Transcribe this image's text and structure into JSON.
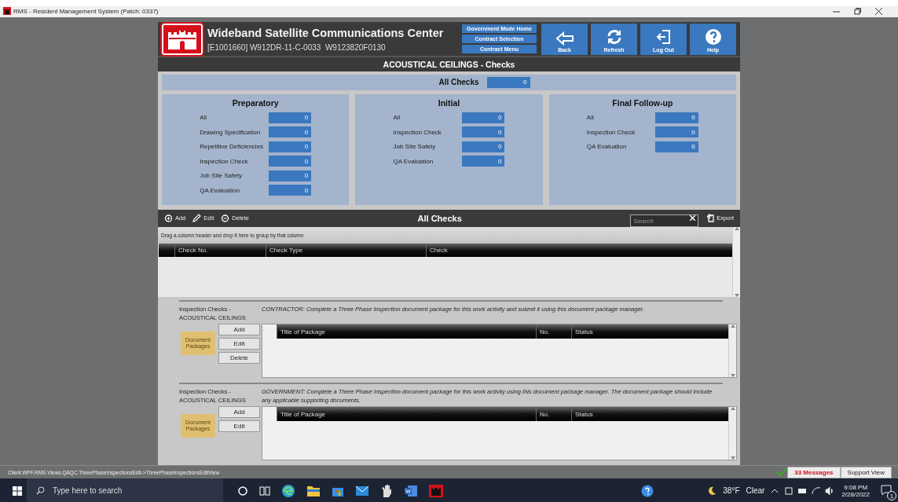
{
  "window": {
    "title": "RMS - Resident Management System (Patch: 0337)"
  },
  "header": {
    "title": "Wideband Satellite Communications Center",
    "subtitle": "[E1001660] W912DR-11-C-0033  W9123820F0130",
    "nav_links": [
      "Government Mode Home",
      "Contract Selection",
      "Contract Menu"
    ],
    "buttons": [
      {
        "label": "Back",
        "kind": "back"
      },
      {
        "label": "Refresh",
        "kind": "refresh"
      },
      {
        "label": "Log Out",
        "kind": "logout"
      },
      {
        "label": "Help",
        "kind": "help"
      }
    ]
  },
  "page_title": "ACOUSTICAL CEILINGS - Checks",
  "all_checks": {
    "label": "All Checks",
    "value": "0"
  },
  "groups": [
    {
      "title": "Preparatory",
      "rows": [
        {
          "label": "All",
          "value": "0"
        },
        {
          "label": "Drawing Specification",
          "value": "0"
        },
        {
          "label": "Repetitive Deficiencies",
          "value": "0"
        },
        {
          "label": "Inspection Check",
          "value": "0"
        },
        {
          "label": "Job Site Safety",
          "value": "0"
        },
        {
          "label": "QA Evaluation",
          "value": "0"
        }
      ]
    },
    {
      "title": "Initial",
      "rows": [
        {
          "label": "All",
          "value": "0"
        },
        {
          "label": "Inspection Check",
          "value": "0"
        },
        {
          "label": "Job Site Safety",
          "value": "0"
        },
        {
          "label": "QA Evaluation",
          "value": "0"
        }
      ]
    },
    {
      "title": "Final Follow-up",
      "rows": [
        {
          "label": "All",
          "value": "0"
        },
        {
          "label": "Inspection Check",
          "value": "0"
        },
        {
          "label": "QA Evaluation",
          "value": "0"
        }
      ]
    }
  ],
  "toolbar": {
    "actions": [
      {
        "label": "Add",
        "kind": "add"
      },
      {
        "label": "Edit",
        "kind": "edit"
      },
      {
        "label": "Delete",
        "kind": "delete"
      }
    ],
    "title": "All Checks",
    "search_placeholder": "Search",
    "export": "Export"
  },
  "grid": {
    "hint": "Drag a column header and drop it here to group by that column",
    "columns": [
      "Check No.",
      "Check Type",
      "Check"
    ]
  },
  "packages": [
    {
      "label": [
        "Inspection Checks -",
        "ACOUSTICAL CEILINGS"
      ],
      "instruction": "CONTRACTOR: Complete a Three Phase Inspection document package for this work activity and submit it using this document package manager.",
      "folder_label": "Document Packages",
      "buttons": [
        "Add",
        "Edit",
        "Delete"
      ],
      "columns": [
        "Title of Package",
        "No.",
        "Status"
      ]
    },
    {
      "label": [
        "Inspection Checks -",
        "ACOUSTICAL CEILINGS"
      ],
      "instruction": "GOVERNMENT: Complete a Three Phase Inspection document package for this work activity using this document package manager. The document package should include any applicable supporting documents.",
      "folder_label": "Document Packages",
      "buttons": [
        "Add",
        "Edit"
      ],
      "columns": [
        "Title of Package",
        "No.",
        "Status"
      ]
    }
  ],
  "status_bar": {
    "path": "Client.WPF.RMS.Views.QAQC.ThreePhaseInspectionsEdit->ThreePhaseInspectionsEditView",
    "messages": "33 Messages",
    "support": "Support View"
  },
  "taskbar": {
    "search_placeholder": "Type here to search",
    "apps": [
      {
        "kind": "cortana"
      },
      {
        "kind": "taskview"
      },
      {
        "kind": "edge"
      },
      {
        "kind": "explorer"
      },
      {
        "kind": "store"
      },
      {
        "kind": "mail"
      },
      {
        "kind": "app"
      },
      {
        "kind": "word"
      },
      {
        "kind": "rms"
      }
    ],
    "temperature": "38°F",
    "weather": "Clear",
    "time": "9:08 PM",
    "date": "2/28/2022",
    "notifications": "1"
  }
}
